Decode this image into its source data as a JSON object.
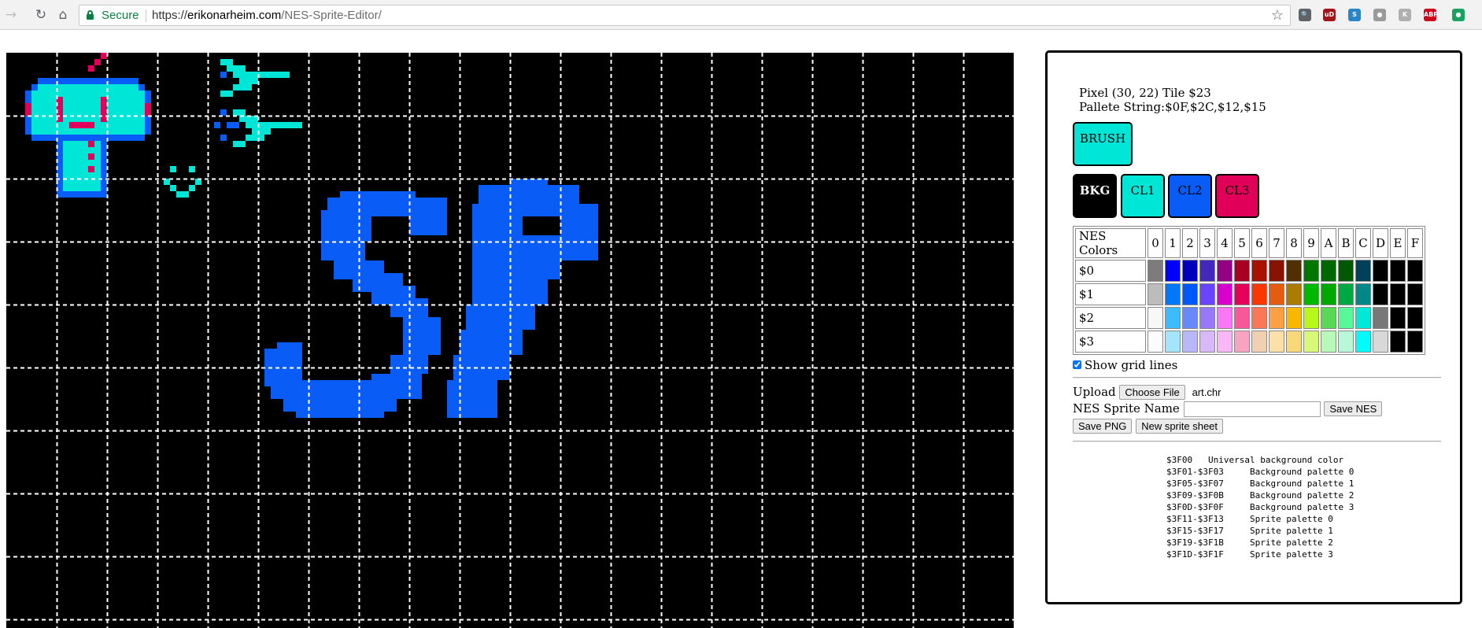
{
  "browser": {
    "secure_label": "Secure",
    "url_scheme": "https://",
    "url_host": "erikonarheim.com",
    "url_path": "/NES-Sprite-Editor/",
    "extensions": [
      {
        "name": "search-ext-icon",
        "color": "#5f6368",
        "glyph": "🔍"
      },
      {
        "name": "ublock-icon",
        "color": "#a4141b",
        "glyph": "uD"
      },
      {
        "name": "s-ext-icon",
        "color": "#2a84c6",
        "glyph": "S"
      },
      {
        "name": "circle-ext-icon",
        "color": "#9a9a9a",
        "glyph": "●"
      },
      {
        "name": "k-ext-icon",
        "color": "#b0b0b0",
        "glyph": "K"
      },
      {
        "name": "adblock-plus-icon",
        "color": "#d0021b",
        "glyph": "ABP"
      },
      {
        "name": "green-ext-icon",
        "color": "#1aa260",
        "glyph": "●"
      }
    ]
  },
  "editor": {
    "pixel_info": "Pixel (30, 22) Tile $23",
    "palette_string": "Pallete String:$0F,$2C,$12,$15",
    "brush_label": "BRUSH",
    "brush_color": "#00e6d6",
    "color_buttons": [
      {
        "label": "BKG",
        "bg": "#000000",
        "fg": "#ffffff",
        "bold": true
      },
      {
        "label": "CL1",
        "bg": "#00e6d6",
        "fg": "#000000",
        "bold": false
      },
      {
        "label": "CL2",
        "bg": "#0a5cf6",
        "fg": "#000000",
        "bold": false
      },
      {
        "label": "CL3",
        "bg": "#e0005a",
        "fg": "#000000",
        "bold": false
      }
    ],
    "palette_header": "NES Colors",
    "palette_columns": [
      "0",
      "1",
      "2",
      "3",
      "4",
      "5",
      "6",
      "7",
      "8",
      "9",
      "A",
      "B",
      "C",
      "D",
      "E",
      "F"
    ],
    "palette_rows": [
      {
        "label": "$0",
        "colors": [
          "#7c7c7c",
          "#0000fc",
          "#0000bc",
          "#4428bc",
          "#940084",
          "#a80020",
          "#a81000",
          "#881400",
          "#503000",
          "#007800",
          "#006800",
          "#005800",
          "#004058",
          "#000000",
          "#000000",
          "#000000"
        ]
      },
      {
        "label": "$1",
        "colors": [
          "#bcbcbc",
          "#0078f8",
          "#0058f8",
          "#6844fc",
          "#d800cc",
          "#e40058",
          "#f83800",
          "#e45c10",
          "#ac7c00",
          "#00b800",
          "#00a800",
          "#00a844",
          "#008888",
          "#000000",
          "#000000",
          "#000000"
        ]
      },
      {
        "label": "$2",
        "colors": [
          "#f8f8f8",
          "#3cbcfc",
          "#6888fc",
          "#9878f8",
          "#f878f8",
          "#f85898",
          "#f87858",
          "#fca044",
          "#f8b800",
          "#b8f818",
          "#58d854",
          "#58f898",
          "#00e8d8",
          "#787878",
          "#000000",
          "#000000"
        ]
      },
      {
        "label": "$3",
        "colors": [
          "#fcfcfc",
          "#a4e4fc",
          "#b8b8f8",
          "#d8b8f8",
          "#f8b8f8",
          "#f8a4c0",
          "#f0d0b0",
          "#fce0a8",
          "#f8d878",
          "#d8f878",
          "#b8f8b8",
          "#b8f8d8",
          "#00fcfc",
          "#d8d8d8",
          "#000000",
          "#000000"
        ]
      }
    ],
    "show_grid_label": "Show grid lines",
    "show_grid_checked": true,
    "upload_label": "Upload",
    "choose_file_label": "Choose File",
    "file_name": "art.chr",
    "sprite_name_label": "NES Sprite Name",
    "sprite_name_value": "",
    "save_nes_label": "Save NES",
    "save_png_label": "Save PNG",
    "new_sheet_label": "New sprite sheet",
    "register_map": [
      "$3F00   Universal background color",
      "$3F01-$3F03     Background palette 0",
      "$3F05-$3F07     Background palette 1",
      "$3F09-$3F0B     Background palette 2",
      "$3F0D-$3F0F     Background palette 3",
      "$3F11-$3F13     Sprite palette 0",
      "$3F15-$3F17     Sprite palette 1",
      "$3F19-$3F1B     Sprite palette 2",
      "$3F1D-$3F1F     Sprite palette 3"
    ]
  },
  "canvas": {
    "grid_color": "#ffffff",
    "colors": {
      "cyan": "#00e6d6",
      "blue": "#0a5cf6",
      "red": "#e0005a"
    }
  }
}
